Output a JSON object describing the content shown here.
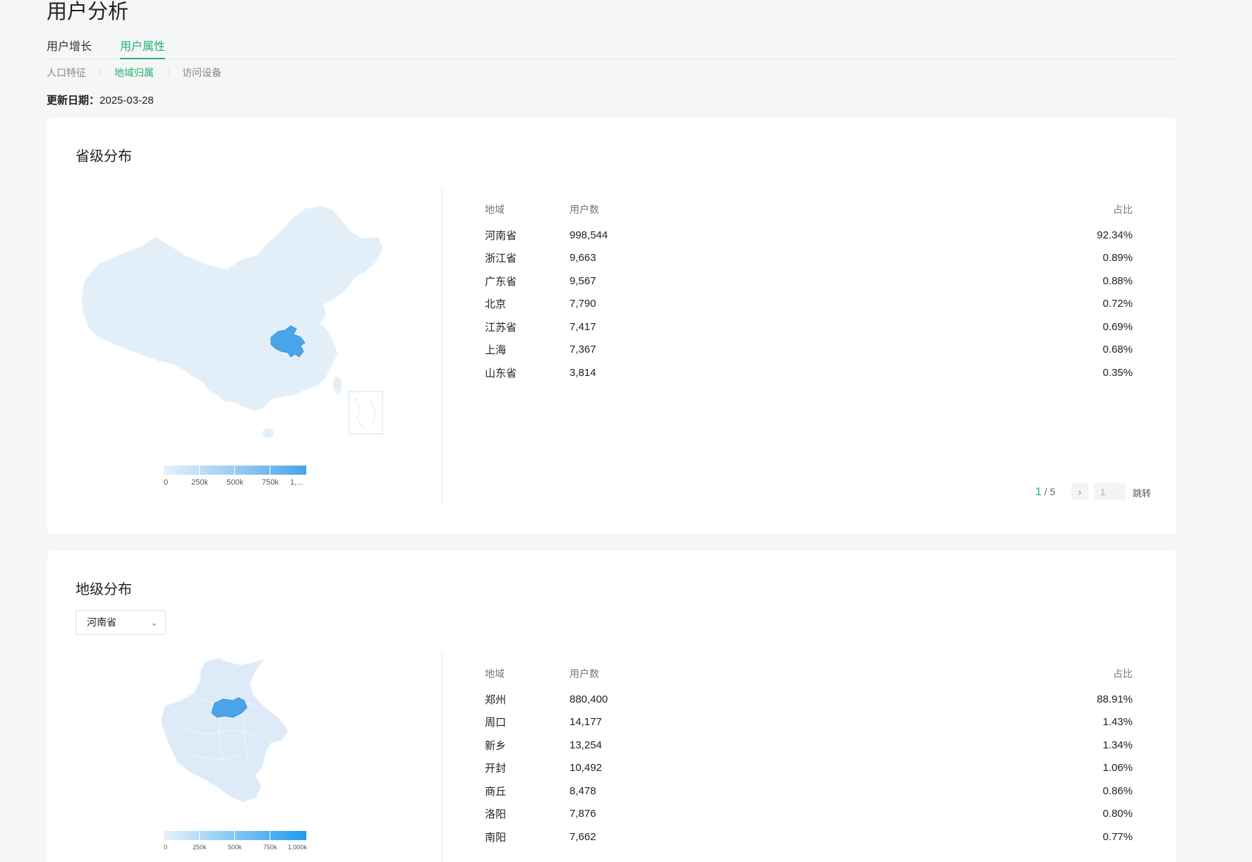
{
  "page": {
    "title": "用户分析",
    "tabs": [
      {
        "label": "用户增长",
        "active": false
      },
      {
        "label": "用户属性",
        "active": true
      }
    ],
    "subtabs": [
      {
        "label": "人口特征",
        "active": false
      },
      {
        "label": "地域归属",
        "active": true
      },
      {
        "label": "访问设备",
        "active": false
      }
    ],
    "update_label": "更新日期：",
    "update_date": "2025-03-28"
  },
  "colors": {
    "accent": "#20b46a",
    "map_base": "#e3eff8",
    "map_high": "#4aa4ea"
  },
  "province": {
    "title": "省级分布",
    "highlighted_region": "河南省",
    "legend": {
      "labels": [
        "0",
        "250k",
        "500k",
        "750k",
        "1,..."
      ]
    },
    "table": {
      "headers": [
        "地域",
        "用户数",
        "占比"
      ],
      "rows": [
        {
          "region": "河南省",
          "users": "998,544",
          "ratio": "92.34%"
        },
        {
          "region": "浙江省",
          "users": "9,663",
          "ratio": "0.89%"
        },
        {
          "region": "广东省",
          "users": "9,567",
          "ratio": "0.88%"
        },
        {
          "region": "北京",
          "users": "7,790",
          "ratio": "0.72%"
        },
        {
          "region": "江苏省",
          "users": "7,417",
          "ratio": "0.69%"
        },
        {
          "region": "上海",
          "users": "7,367",
          "ratio": "0.68%"
        },
        {
          "region": "山东省",
          "users": "3,814",
          "ratio": "0.35%"
        }
      ]
    },
    "pager": {
      "current": "1",
      "sep_total": " / 5",
      "next_icon": "chevron-right-icon",
      "next_glyph": "›",
      "input_value": "1",
      "jump_label": "跳转"
    }
  },
  "city": {
    "title": "地级分布",
    "select_value": "河南省",
    "select_icon": "chevron-down-icon",
    "highlighted_region": "郑州",
    "legend": {
      "labels": [
        "0",
        "250k",
        "500k",
        "750k",
        "1,000k"
      ]
    },
    "table": {
      "headers": [
        "地域",
        "用户数",
        "占比"
      ],
      "rows": [
        {
          "region": "郑州",
          "users": "880,400",
          "ratio": "88.91%"
        },
        {
          "region": "周口",
          "users": "14,177",
          "ratio": "1.43%"
        },
        {
          "region": "新乡",
          "users": "13,254",
          "ratio": "1.34%"
        },
        {
          "region": "开封",
          "users": "10,492",
          "ratio": "1.06%"
        },
        {
          "region": "商丘",
          "users": "8,478",
          "ratio": "0.86%"
        },
        {
          "region": "洛阳",
          "users": "7,876",
          "ratio": "0.80%"
        },
        {
          "region": "南阳",
          "users": "7,662",
          "ratio": "0.77%"
        }
      ]
    }
  }
}
